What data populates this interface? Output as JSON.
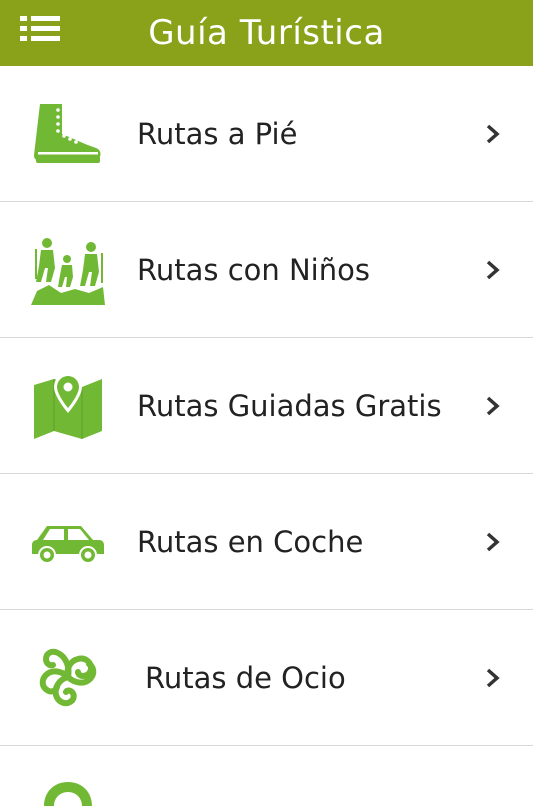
{
  "header": {
    "title": "Guía Turística",
    "menu_icon": "list-menu-icon",
    "background": "#8aa21a"
  },
  "accent_color": "#71b934",
  "items": [
    {
      "label": "Rutas a Pié",
      "icon": "hiking-boot-icon"
    },
    {
      "label": "Rutas con Niños",
      "icon": "family-hiking-icon"
    },
    {
      "label": "Rutas Guiadas Gratis",
      "icon": "map-pin-icon"
    },
    {
      "label": "Rutas en Coche",
      "icon": "car-icon"
    },
    {
      "label": "Rutas de Ocio",
      "icon": "triskelion-icon"
    },
    {
      "label": "",
      "icon": "location-pin-icon"
    }
  ]
}
